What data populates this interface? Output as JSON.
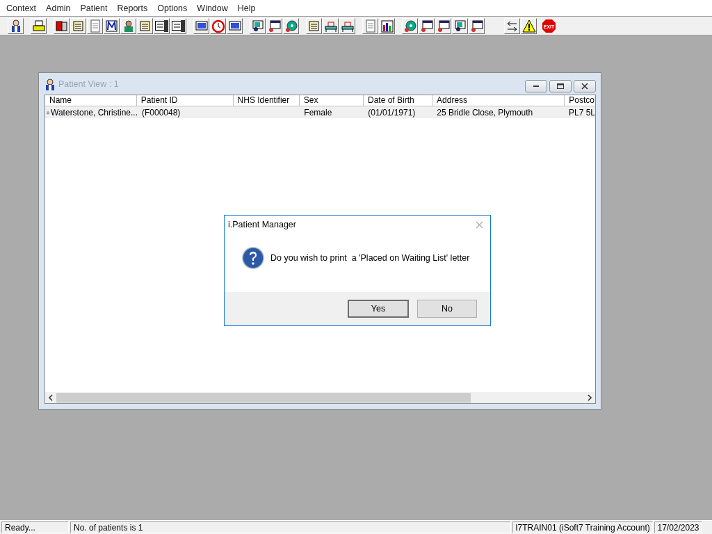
{
  "menu": [
    "Context",
    "Admin",
    "Patient",
    "Reports",
    "Options",
    "Window",
    "Help"
  ],
  "toolbar": {
    "exit_label": "EXIT"
  },
  "patient_window": {
    "title": "Patient View : 1",
    "columns": [
      "Name",
      "Patient ID",
      "NHS Identifier",
      "Sex",
      "Date of Birth",
      "Address",
      "Postco"
    ],
    "rows": [
      {
        "cells": [
          "Waterstone, Christine...",
          "(F000048)",
          "",
          "Female",
          "(01/01/1971)",
          "25 Bridle Close, Plymouth",
          "PL7 5L"
        ],
        "selected": true
      }
    ]
  },
  "dialog": {
    "title": "i.Patient Manager",
    "message": "Do you wish to print  a 'Placed on Waiting List' letter",
    "buttons": [
      "Yes",
      "No"
    ]
  },
  "status_bar": [
    "Ready...",
    "No. of patients is 1",
    "I7TRAIN01 (iSoft7 Training Account)",
    "17/02/2023"
  ]
}
